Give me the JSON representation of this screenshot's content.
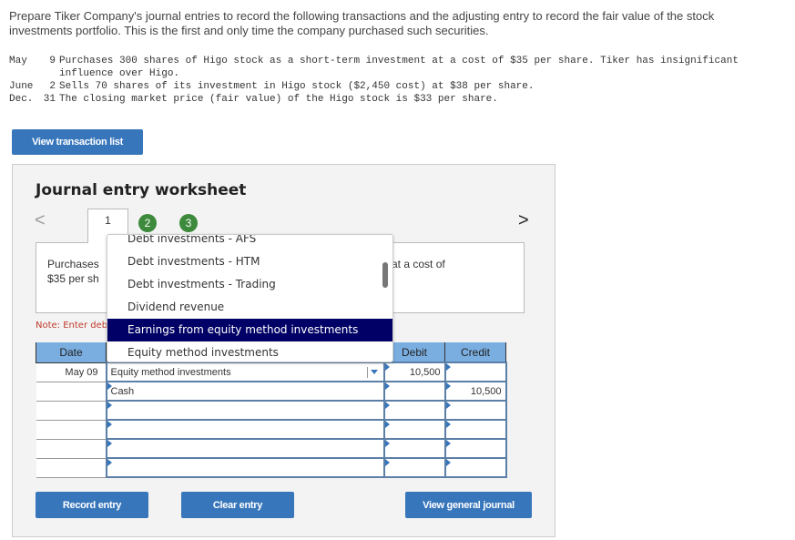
{
  "intro": "Prepare Tiker Company's journal entries to record the following transactions and the adjusting entry to record the fair value of the stock investments portfolio. This is the first and only time the company purchased such securities.",
  "transactions": [
    {
      "month": "May",
      "day": "9",
      "text": "Purchases 300 shares of Higo stock as a short-term investment at a cost of $35 per share. Tiker has insignificant influence over Higo."
    },
    {
      "month": "June",
      "day": "2",
      "text": "Sells 70 shares of its investment in Higo stock ($2,450 cost) at $38 per share."
    },
    {
      "month": "Dec.",
      "day": "31",
      "text": "The closing market price (fair value) of the Higo stock is $33 per share."
    }
  ],
  "buttons": {
    "view_transaction_list": "View transaction list",
    "record_entry": "Record entry",
    "clear_entry": "Clear entry",
    "view_general_journal": "View general journal"
  },
  "worksheet": {
    "title": "Journal entry worksheet",
    "prev": "<",
    "next": ">",
    "tabs": [
      "1",
      "2",
      "3"
    ],
    "description_left_1": "Purchases",
    "description_left_2": "$35 per sh",
    "description_right": "at a cost of",
    "note": "Note: Enter deb"
  },
  "table": {
    "headers": {
      "date": "Date",
      "debit": "Debit",
      "credit": "Credit"
    },
    "rows": [
      {
        "date": "May 09",
        "account": "Equity method investments",
        "debit": "10,500",
        "credit": ""
      },
      {
        "date": "",
        "account": "Cash",
        "debit": "",
        "credit": "10,500"
      },
      {
        "date": "",
        "account": "",
        "debit": "",
        "credit": ""
      },
      {
        "date": "",
        "account": "",
        "debit": "",
        "credit": ""
      },
      {
        "date": "",
        "account": "",
        "debit": "",
        "credit": ""
      },
      {
        "date": "",
        "account": "",
        "debit": "",
        "credit": ""
      }
    ]
  },
  "dropdown": {
    "options": [
      "Debt investments - AFS",
      "Debt investments - HTM",
      "Debt investments - Trading",
      "Dividend revenue",
      "Earnings from equity method investments",
      "Equity method investments"
    ],
    "highlighted": "Earnings from equity method investments"
  }
}
